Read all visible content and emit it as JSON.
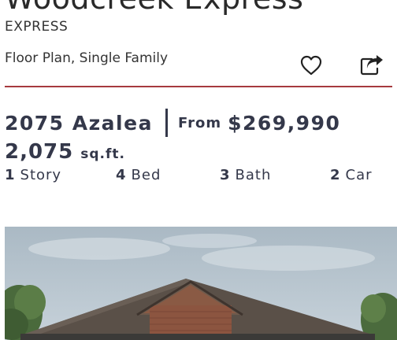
{
  "community": {
    "title": "Woodcreek Express",
    "series": "EXPRESS"
  },
  "plan": {
    "type": "Floor Plan, Single Family",
    "name": "2075 Azalea",
    "from_label": "From",
    "price": "$269,990",
    "sqft_value": "2,075",
    "sqft_unit": "sq.ft."
  },
  "specs": [
    {
      "num": "1",
      "label": "Story"
    },
    {
      "num": "4",
      "label": "Bed"
    },
    {
      "num": "3",
      "label": "Bath"
    },
    {
      "num": "2",
      "label": "Car"
    }
  ],
  "actions": {
    "favorite_icon": "heart-outline",
    "share_icon": "share-arrow"
  },
  "colors": {
    "accent_line": "#a63a3e",
    "heading_text": "#34384a"
  }
}
